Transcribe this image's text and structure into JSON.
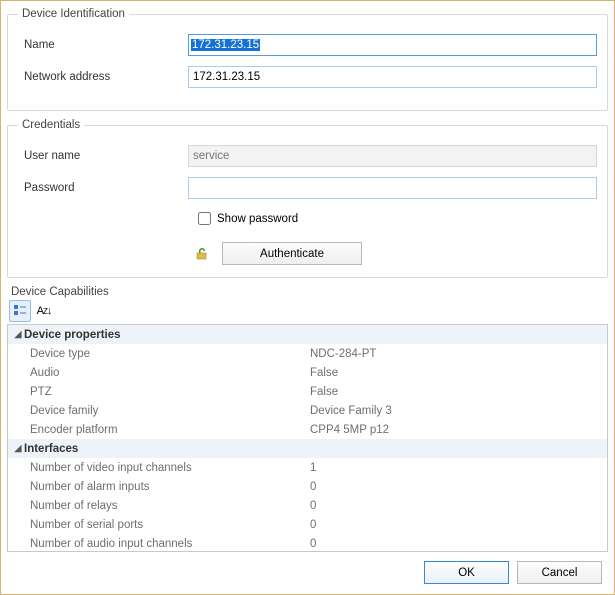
{
  "identification": {
    "legend": "Device Identification",
    "name_label": "Name",
    "name_value": "172.31.23.15",
    "addr_label": "Network address",
    "addr_value": "172.31.23.15"
  },
  "credentials": {
    "legend": "Credentials",
    "user_label": "User name",
    "user_value": "service",
    "pass_label": "Password",
    "pass_value": "",
    "show_pass_label": "Show password",
    "show_pass_checked": false,
    "auth_button": "Authenticate"
  },
  "capabilities": {
    "label": "Device Capabilities",
    "groups": [
      {
        "title": "Device properties",
        "rows": [
          {
            "name": "Device type",
            "value": "NDC-284-PT"
          },
          {
            "name": "Audio",
            "value": "False"
          },
          {
            "name": "PTZ",
            "value": "False"
          },
          {
            "name": "Device family",
            "value": "Device Family 3"
          },
          {
            "name": "Encoder platform",
            "value": "CPP4 5MP p12"
          }
        ]
      },
      {
        "title": "Interfaces",
        "rows": [
          {
            "name": "Number of video input channels",
            "value": "1"
          },
          {
            "name": "Number of alarm inputs",
            "value": "0"
          },
          {
            "name": "Number of relays",
            "value": "0"
          },
          {
            "name": "Number of serial ports",
            "value": "0"
          },
          {
            "name": "Number of audio input channels",
            "value": "0"
          }
        ]
      }
    ]
  },
  "buttons": {
    "ok": "OK",
    "cancel": "Cancel"
  }
}
